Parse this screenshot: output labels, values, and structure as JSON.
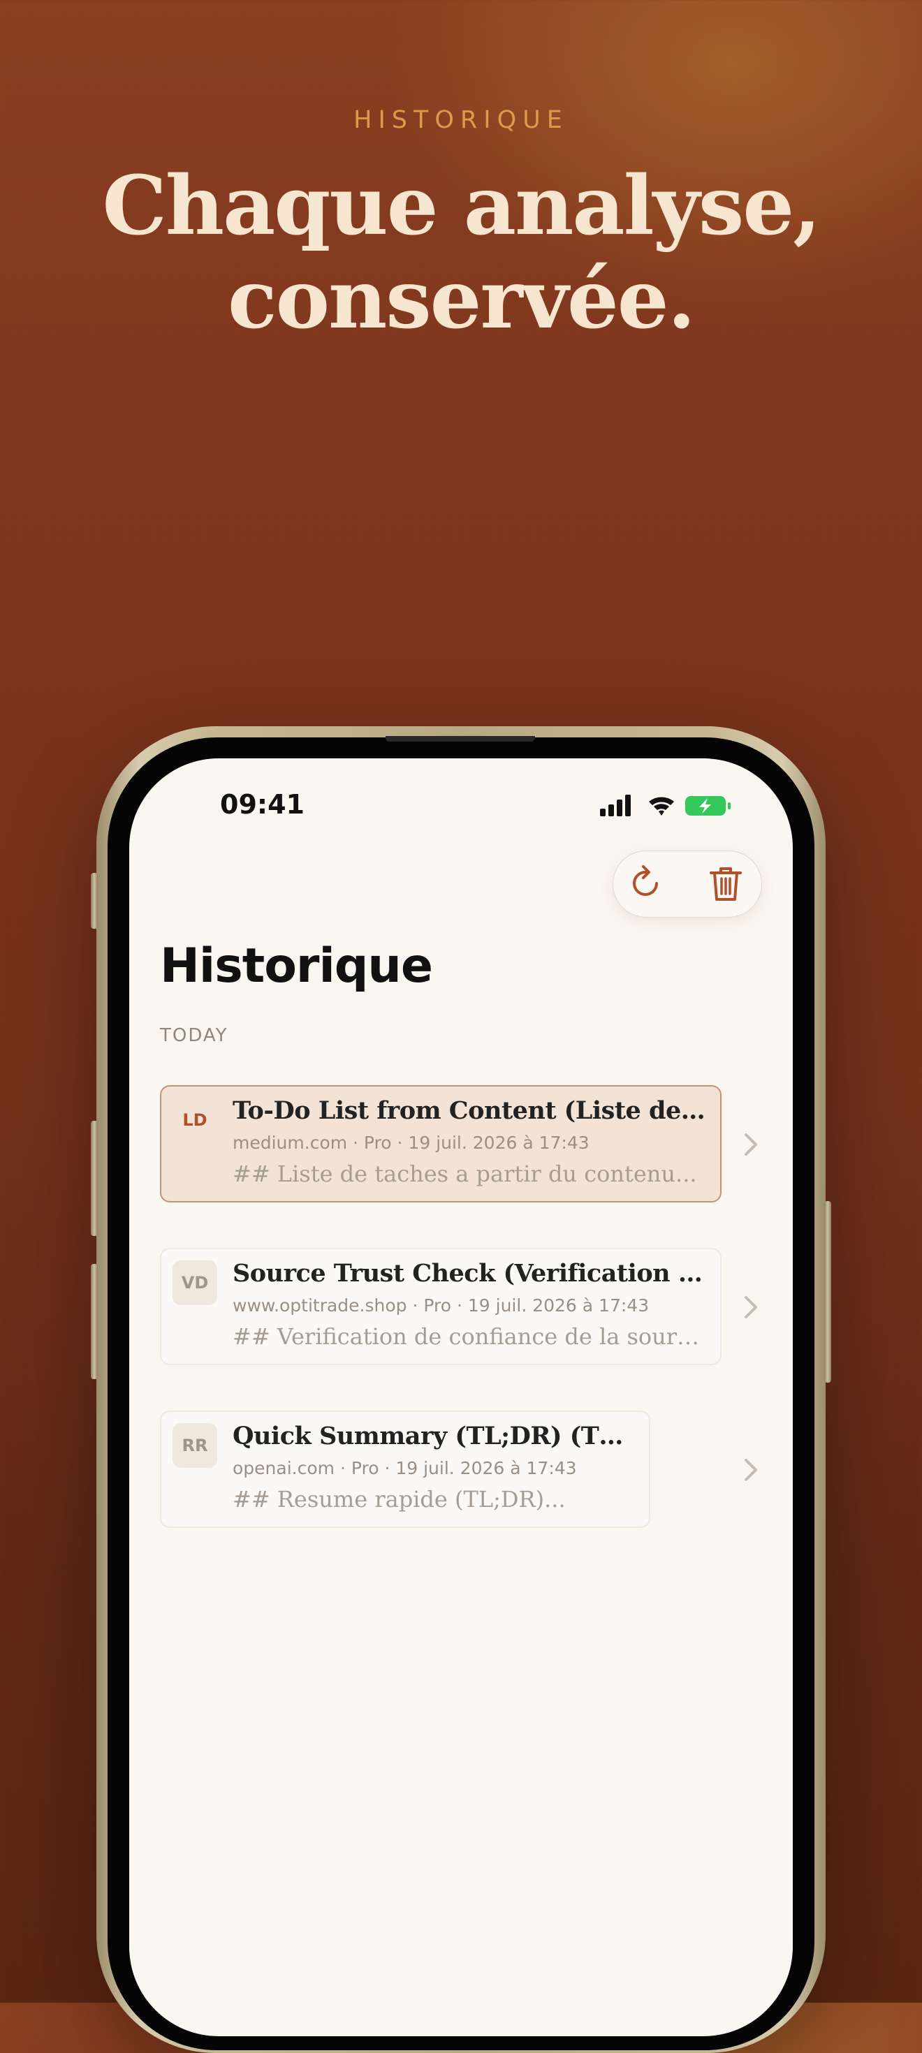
{
  "hero": {
    "eyebrow": "HISTORIQUE",
    "headline_line1": "Chaque analyse,",
    "headline_line2": "conservée."
  },
  "status_bar": {
    "time": "09:41",
    "icons": [
      "signal-icon",
      "wifi-icon",
      "battery-charging-icon"
    ]
  },
  "toolbar": {
    "refresh_icon": "refresh-icon",
    "delete_icon": "trash-icon"
  },
  "page": {
    "title": "Historique",
    "section": "TODAY"
  },
  "history": [
    {
      "initials": "LD",
      "title": "To-Do List from Content (Liste de tac...",
      "meta": "medium.com · Pro · 19 juil. 2026 à 17:43",
      "snippet": "## Liste de taches a partir du contenu...",
      "selected": true
    },
    {
      "initials": "VD",
      "title": "Source Trust Check (Verification de c...",
      "meta": "www.optitrade.shop · Pro · 19 juil. 2026 à 17:43",
      "snippet": "## Verification de confiance de la source...",
      "selected": false
    },
    {
      "initials": "RR",
      "title": "Quick Summary (TL;DR) (TL;DR)",
      "meta": "openai.com · Pro · 19 juil. 2026 à 17:43",
      "snippet": "## Resume rapide (TL;DR)...",
      "selected": false
    }
  ],
  "colors": {
    "accent": "#b0502d",
    "background_top": "#8a3f21",
    "eyebrow": "#dd9a4a",
    "headline": "#f6e6cf",
    "screen_bg": "#faf7f1",
    "battery": "#34c759"
  }
}
